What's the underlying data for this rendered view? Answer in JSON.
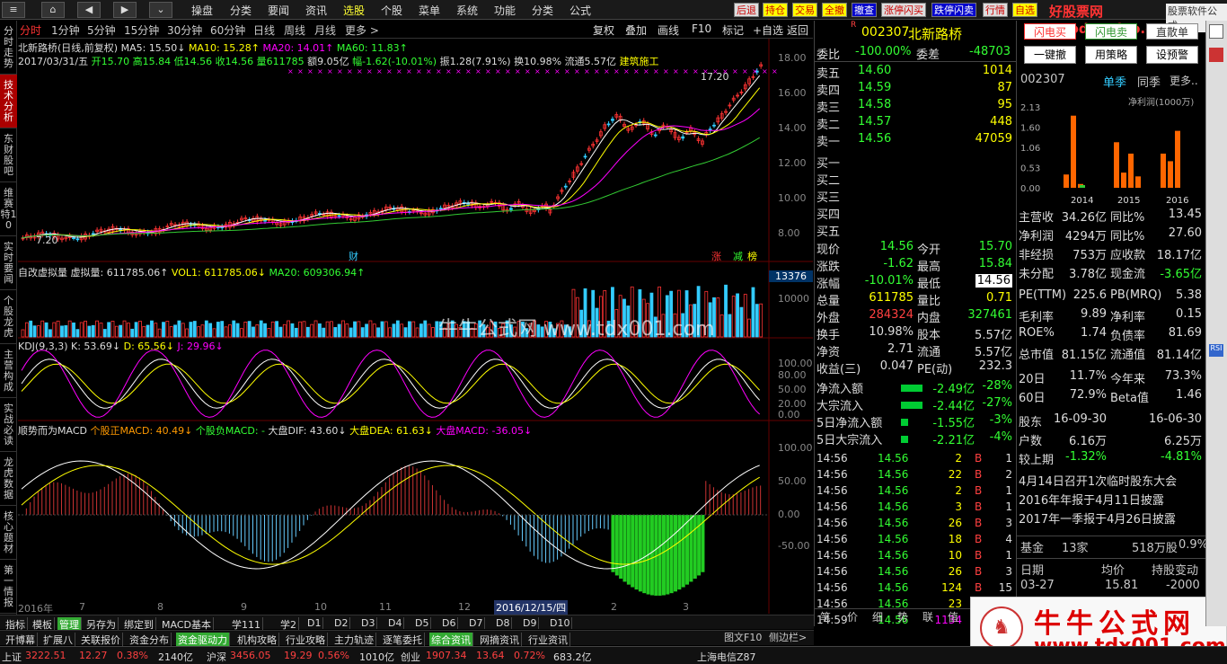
{
  "topbar": {
    "menus": [
      "操盘",
      "分类",
      "要闻",
      "资讯",
      "选股",
      "个股",
      "菜单",
      "系统",
      "功能",
      "分类",
      "公式"
    ],
    "active_menu": "选股",
    "right_buttons": [
      "后退",
      "持仓",
      "交易",
      "全撤",
      "撤查",
      "涨停闪买",
      "跌停闪卖",
      "行情",
      "自选"
    ],
    "watermark_top": "好股票网Goodgupiao.com",
    "corner_label": "股票软件公式"
  },
  "left_tabs": [
    "分时走势",
    "技术分析",
    "东财股吧",
    "维赛特10",
    "实时要闻",
    "个股龙虎",
    "主营构成",
    "实战必读",
    "龙虎数据",
    "核心题材",
    "第一情报"
  ],
  "periods": [
    "分时",
    "1分钟",
    "5分钟",
    "15分钟",
    "30分钟",
    "60分钟",
    "日线",
    "周线",
    "月线",
    "更多 >"
  ],
  "active_period": "分时",
  "tools": [
    "复权",
    "叠加",
    "画线",
    "F10",
    "标记",
    "+自选",
    "返回"
  ],
  "chart_info": {
    "line1": {
      "name": "北新路桥(日线,前复权)",
      "ma5": "MA5: 15.50↓",
      "ma10": "MA10: 15.28↑",
      "ma20": "MA20: 14.01↑",
      "ma60": "MA60: 11.83↑"
    },
    "line2": {
      "date": "2017/03/31/五",
      "open": "开15.70",
      "high": "高15.84",
      "low": "低14.56",
      "close": "收14.56",
      "vol": "量611785",
      "amt": "额9.05亿",
      "chg": "幅-1.62(-10.01%)",
      "amp": "振1.28(7.91%)",
      "turn": "换10.98%",
      "float": "流通5.57亿",
      "ind": "建筑施工"
    },
    "price_ticks": [
      "18.00",
      "16.00",
      "14.00",
      "12.00",
      "10.00",
      "8.00"
    ],
    "hi_label": "17.20",
    "lo_label": "7.20",
    "cai": "财",
    "zhang": "涨",
    "jian": "减",
    "bang": "榜",
    "vol_title": "自改虚拟量",
    "vol_val": "虚拟量: 611785.06↑",
    "vol1": "VOL1: 611785.06↓",
    "vol_ma20": "MA20: 609306.94↑",
    "vol_box": "13376",
    "vol_tick": "10000",
    "kdj_title": "KDJ(9,3,3)",
    "kdj_k": "K: 53.69↓",
    "kdj_d": "D: 65.56↓",
    "kdj_j": "J: 29.96↓",
    "kdj_ticks": [
      "100.00",
      "80.00",
      "50.00",
      "20.00",
      "0.00"
    ],
    "macd_title": "顺势而为MACD",
    "macd_a": "个股正MACD: 40.49↓",
    "macd_b": "个股负MACD: -",
    "macd_c": "大盘DIF: 43.60↓",
    "macd_d": "大盘DEA: 61.63↓",
    "macd_e": "大盘MACD: -36.05↓",
    "macd_ticks": [
      "100.00",
      "50.00",
      "0.00",
      "-50.00"
    ],
    "x_labels": [
      "2016年",
      "7",
      "8",
      "9",
      "10",
      "11",
      "12",
      "2016/12/15/四",
      "2",
      "3"
    ],
    "watermark": "牛牛公式网 www.tdx001.com"
  },
  "bottom_tabs1": [
    "指标",
    "模板",
    "管理",
    "另存为",
    "绑定到",
    "MACD基本",
    "学111",
    "学2",
    "D1",
    "D2",
    "D3",
    "D4",
    "D5",
    "D6",
    "D7",
    "D8",
    "D9",
    "D10"
  ],
  "bottom_tabs2": [
    "开博幕",
    "扩展八",
    "关联报价",
    "资金分布",
    "资金驱动力",
    "机构攻略",
    "行业攻略",
    "主力轨迹",
    "逐笔委托",
    "综合资讯",
    "网摘资讯",
    "行业资讯"
  ],
  "bottom_right": [
    "图文F10",
    "侧边栏>"
  ],
  "quote": {
    "code": "002307",
    "name": "北新路桥",
    "r": "R",
    "weibi_label": "委比",
    "weibi": "-100.00%",
    "weicha_label": "委差",
    "weicha": "-48703",
    "sells": [
      {
        "l": "卖五",
        "p": "14.60",
        "v": "1014"
      },
      {
        "l": "卖四",
        "p": "14.59",
        "v": "87"
      },
      {
        "l": "卖三",
        "p": "14.58",
        "v": "95"
      },
      {
        "l": "卖二",
        "p": "14.57",
        "v": "448"
      },
      {
        "l": "卖一",
        "p": "14.56",
        "v": "47059"
      }
    ],
    "buys": [
      "买一",
      "买二",
      "买三",
      "买四",
      "买五"
    ],
    "stats": [
      {
        "a": "现价",
        "av": "14.56",
        "b": "今开",
        "bv": "15.70"
      },
      {
        "a": "涨跌",
        "av": "-1.62",
        "b": "最高",
        "bv": "15.84"
      },
      {
        "a": "涨幅",
        "av": "-10.01%",
        "b": "最低",
        "bv": "14.56"
      },
      {
        "a": "总量",
        "av": "611785",
        "b": "量比",
        "bv": "0.71"
      },
      {
        "a": "外盘",
        "av": "284324",
        "b": "内盘",
        "bv": "327461"
      },
      {
        "a": "换手",
        "av": "10.98%",
        "b": "股本",
        "bv": "5.57亿"
      },
      {
        "a": "净资",
        "av": "2.71",
        "b": "流通",
        "bv": "5.57亿"
      },
      {
        "a": "收益(三)",
        "av": "0.047",
        "b": "PE(动)",
        "bv": "232.3"
      }
    ],
    "flows": [
      {
        "l": "净流入额",
        "v": "-2.49亿",
        "p": "-28%"
      },
      {
        "l": "大宗流入",
        "v": "-2.44亿",
        "p": "-27%"
      },
      {
        "l": "5日净流入额",
        "v": "-1.55亿",
        "p": "-3%"
      },
      {
        "l": "5日大宗流入",
        "v": "-2.21亿",
        "p": "-4%"
      }
    ],
    "ticks": [
      {
        "t": "14:56",
        "p": "14.56",
        "v": "2",
        "d": "B",
        "n": "1"
      },
      {
        "t": "14:56",
        "p": "14.56",
        "v": "22",
        "d": "B",
        "n": "2"
      },
      {
        "t": "14:56",
        "p": "14.56",
        "v": "2",
        "d": "B",
        "n": "1"
      },
      {
        "t": "14:56",
        "p": "14.56",
        "v": "3",
        "d": "B",
        "n": "1"
      },
      {
        "t": "14:56",
        "p": "14.56",
        "v": "26",
        "d": "B",
        "n": "3"
      },
      {
        "t": "14:56",
        "p": "14.56",
        "v": "18",
        "d": "B",
        "n": "4"
      },
      {
        "t": "14:56",
        "p": "14.56",
        "v": "10",
        "d": "B",
        "n": "1"
      },
      {
        "t": "14:56",
        "p": "14.56",
        "v": "26",
        "d": "B",
        "n": "3"
      },
      {
        "t": "14:56",
        "p": "14.56",
        "v": "124",
        "d": "B",
        "n": "15"
      },
      {
        "t": "14:56",
        "p": "14.56",
        "v": "23",
        "d": "B",
        "n": "1"
      },
      {
        "t": "14:59",
        "p": "14.56",
        "v": "1134",
        "d": "",
        "n": ""
      }
    ],
    "bottom_tabs": [
      "笔",
      "价",
      "细",
      "势",
      "联",
      "值",
      "主"
    ]
  },
  "right_panel": {
    "buttons": [
      "闪电买",
      "闪电卖",
      "直散单",
      "一键撤",
      "用策略",
      "设预警"
    ],
    "code": "002307",
    "single": "单季",
    "same": "同季",
    "more": "更多..",
    "chart_title": "净利润(1000万)",
    "y_ticks": [
      "2.13",
      "1.60",
      "1.06",
      "0.53",
      "0.00"
    ],
    "x_ticks": [
      "2014",
      "2015",
      "2016"
    ],
    "fin": [
      {
        "a": "主营收",
        "av": "34.26亿",
        "b": "同比%",
        "bv": "13.45"
      },
      {
        "a": "净利润",
        "av": "4294万",
        "b": "同比%",
        "bv": "27.60"
      },
      {
        "a": "非经损",
        "av": "753万",
        "b": "应收款",
        "bv": "18.17亿"
      },
      {
        "a": "未分配",
        "av": "3.78亿",
        "b": "现金流",
        "bv": "-3.65亿"
      },
      {
        "a": "PE(TTM)",
        "av": "225.6",
        "b": "PB(MRQ)",
        "bv": "5.38"
      },
      {
        "a": "毛利率",
        "av": "9.89",
        "b": "净利率",
        "bv": "0.15"
      },
      {
        "a": "ROE%",
        "av": "1.74",
        "b": "负债率",
        "bv": "81.69"
      },
      {
        "a": "总市值",
        "av": "81.15亿",
        "b": "流通值",
        "bv": "81.14亿"
      },
      {
        "a": "20日",
        "av": "11.7%",
        "b": "今年来",
        "bv": "73.3%"
      },
      {
        "a": "60日",
        "av": "72.9%",
        "b": "Beta值",
        "bv": "1.46"
      },
      {
        "a": "股东",
        "av": "16-09-30",
        "b": "",
        "bv": "16-06-30"
      },
      {
        "a": "户数",
        "av": "6.16万",
        "b": "",
        "bv": "6.25万"
      },
      {
        "a": "较上期",
        "av": "-1.32%",
        "b": "",
        "bv": "-4.81%"
      }
    ],
    "news": [
      "4月14日召开1次临时股东大会",
      "2016年年报于4月11日披露",
      "2017年一季报于4月26日披露"
    ],
    "fund": {
      "a": "基金",
      "b": "13家",
      "c": "518万股",
      "d": "0.9%"
    },
    "hold": {
      "a": "日期",
      "b": "均价",
      "c": "持股变动",
      "d": "03-27",
      "e": "15.81",
      "f": "-2000"
    },
    "logo_text": "牛牛公式网",
    "logo_url": "www.tdx001.com"
  },
  "status": {
    "sh_label": "上证",
    "sh": "3222.51",
    "sh_chg": "12.27",
    "sh_pct": "0.38%",
    "sh_amt": "2140亿",
    "hs_label": "沪深",
    "hs": "3456.05",
    "hs_chg": "19.29",
    "hs_pct": "0.56%",
    "hs_amt": "1010亿",
    "cy_label": "创业",
    "cy": "1907.34",
    "cy_chg": "13.64",
    "cy_pct": "0.72%",
    "cy_amt": "683.2亿",
    "server": "上海电信Z87"
  },
  "chart_data": {
    "type": "line",
    "title": "北新路桥(日线,前复权)",
    "x": [
      "2016年",
      "7",
      "8",
      "9",
      "10",
      "11",
      "12",
      "2016/12/15/四",
      "2",
      "3"
    ],
    "price_range": [
      7.2,
      17.2
    ],
    "series": [
      {
        "name": "MA5",
        "values": [
          7.6,
          8.2,
          8.6,
          9.0,
          9.2,
          9.6,
          9.9,
          9.0,
          12.6,
          13.8,
          15.5
        ]
      },
      {
        "name": "MA60",
        "values": [
          7.6,
          7.9,
          8.3,
          8.6,
          8.8,
          9.0,
          9.2,
          9.3,
          10.0,
          11.0,
          11.83
        ]
      }
    ]
  }
}
